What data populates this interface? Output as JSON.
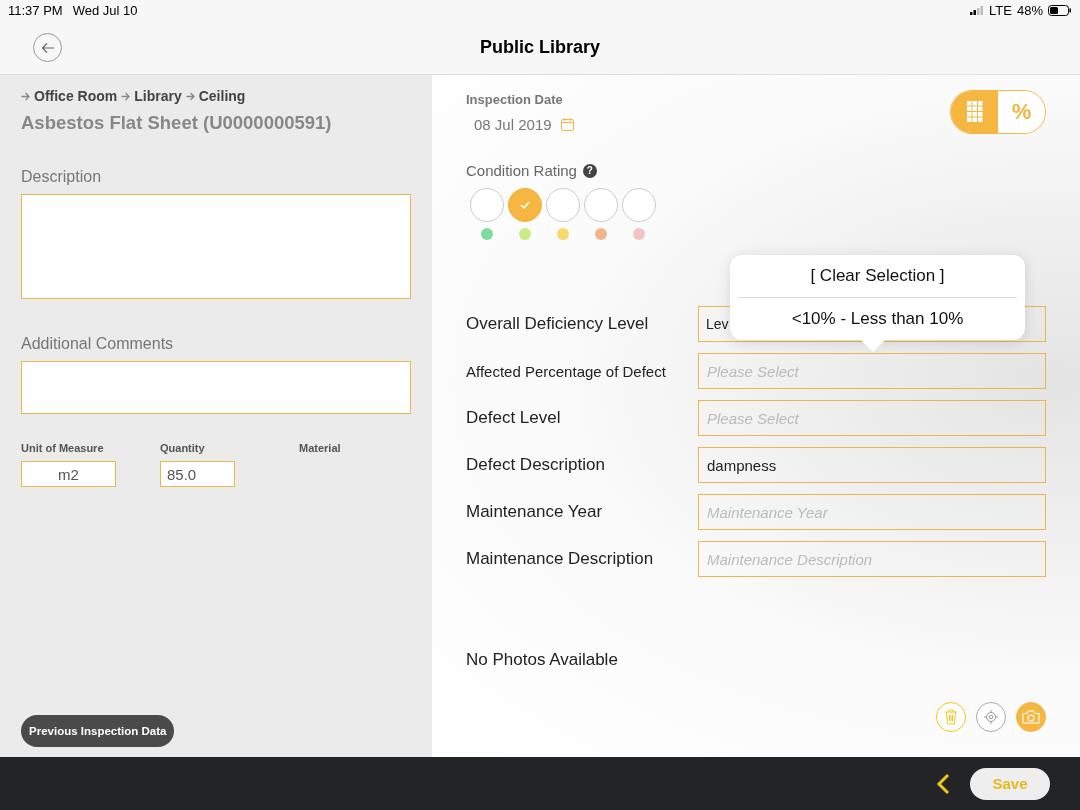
{
  "status_bar": {
    "time": "11:37 PM",
    "date": "Wed Jul 10",
    "network": "LTE",
    "battery": "48%"
  },
  "nav": {
    "title": "Public Library"
  },
  "asset": {
    "breadcrumb": [
      "Office Room",
      "Library",
      "Ceiling"
    ],
    "title": "Asbestos Flat Sheet (U0000000591)"
  },
  "description": {
    "label": "Description"
  },
  "comments": {
    "label": "Additional Comments"
  },
  "measures": [
    {
      "label": "Unit of Measure",
      "kind": "field",
      "value": "m2"
    },
    {
      "label": "Quantity",
      "kind": "field",
      "value": "85.0"
    },
    {
      "label": "Material",
      "kind": "text"
    }
  ],
  "previous_button": "Previous Inspection Data",
  "inspection_date": {
    "label": "Inspection Date",
    "value": "08 Jul 2019"
  },
  "mode_toggle": [
    {
      "kind": "grid",
      "selected": true
    },
    {
      "kind": "text",
      "label": "%",
      "selected": false
    }
  ],
  "condition_rating": {
    "label": "Condition Rating",
    "help": "?",
    "options": [
      {
        "selected": false,
        "color": "#7fdc9c"
      },
      {
        "selected": true,
        "color": "#cdeb84"
      },
      {
        "selected": false,
        "color": "#f7d96c"
      },
      {
        "selected": false,
        "color": "#f2b48c"
      },
      {
        "selected": false,
        "color": "#f0c4c4"
      }
    ]
  },
  "form": [
    {
      "label": "Overall Deficiency Level",
      "value": "Lev"
    },
    {
      "label": "Affected Percentage of Defect",
      "placeholder": "Please Select"
    },
    {
      "label": "Defect Level",
      "placeholder": "Please Select"
    },
    {
      "label": "Defect Description",
      "value": "dampness"
    },
    {
      "label": "Maintenance Year",
      "placeholder": "Maintenance Year"
    },
    {
      "label": "Maintenance Description",
      "placeholder": "Maintenance Description"
    }
  ],
  "popover": {
    "options": [
      "[ Clear Selection ]",
      "<10% - Less than 10%"
    ]
  },
  "photos": {
    "empty_text": "No Photos Available"
  },
  "bottom_bar": {
    "save": "Save"
  }
}
